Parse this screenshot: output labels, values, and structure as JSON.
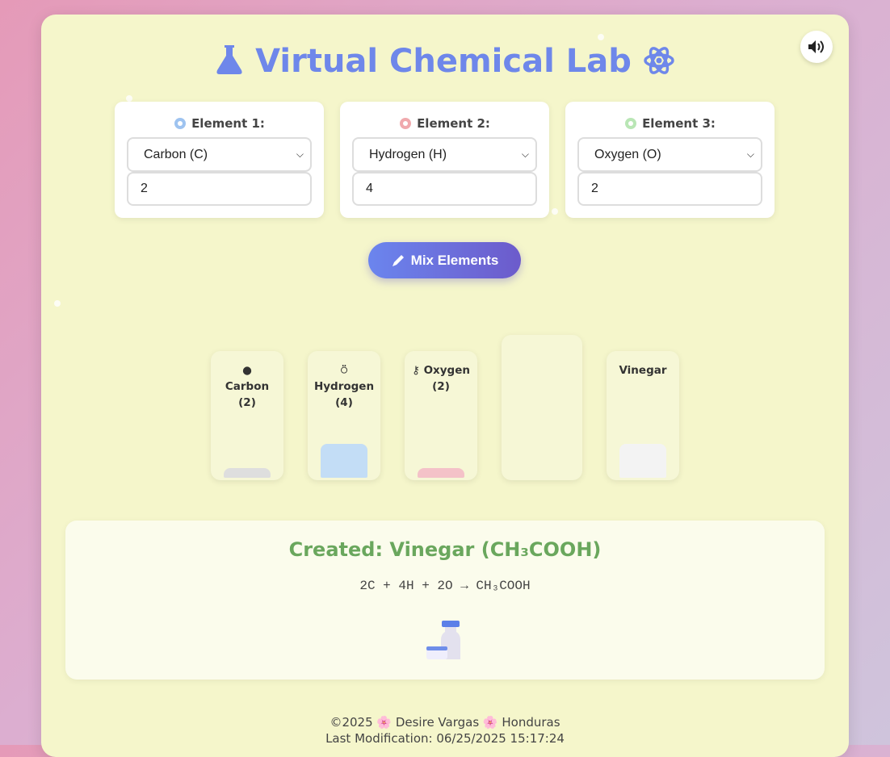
{
  "app": {
    "title": "Virtual Chemical Lab"
  },
  "elements": [
    {
      "label": "Element 1:",
      "selected": "Carbon (C)",
      "quantity": "2",
      "icon_color": "#9ec3f0"
    },
    {
      "label": "Element 2:",
      "selected": "Hydrogen (H)",
      "quantity": "4",
      "icon_color": "#f0a9ad"
    },
    {
      "label": "Element 3:",
      "selected": "Oxygen (O)",
      "quantity": "2",
      "icon_color": "#b9e6b5"
    }
  ],
  "mix_button": {
    "label": "Mix Elements"
  },
  "beakers": [
    {
      "icon": "●",
      "name": "Carbon",
      "count": "(2)",
      "liquid_color": "#dedede",
      "fill": 0.08
    },
    {
      "icon": "⍥",
      "name": "Hydrogen",
      "count": "(4)",
      "liquid_color": "#c3ddf6",
      "fill": 0.3
    },
    {
      "icon": "⚷",
      "name": "Oxygen",
      "count": "(2)",
      "liquid_color": "#f4c2c8",
      "fill": 0.08
    },
    {
      "icon": "",
      "name": "",
      "count": "",
      "liquid_color": "#f6f7d6",
      "fill": 0.0
    },
    {
      "icon": "",
      "name": "Vinegar",
      "count": "",
      "liquid_color": "#f3f3f3",
      "fill": 0.3
    }
  ],
  "result": {
    "title": "Created: Vinegar (CH₃COOH)",
    "equation": "2C + 4H + 2O → CH₃COOH"
  },
  "footer": {
    "line1": "©2025 🌸 Desire Vargas 🌸 Honduras",
    "line2": "Last Modification: 06/25/2025 15:17:24"
  }
}
